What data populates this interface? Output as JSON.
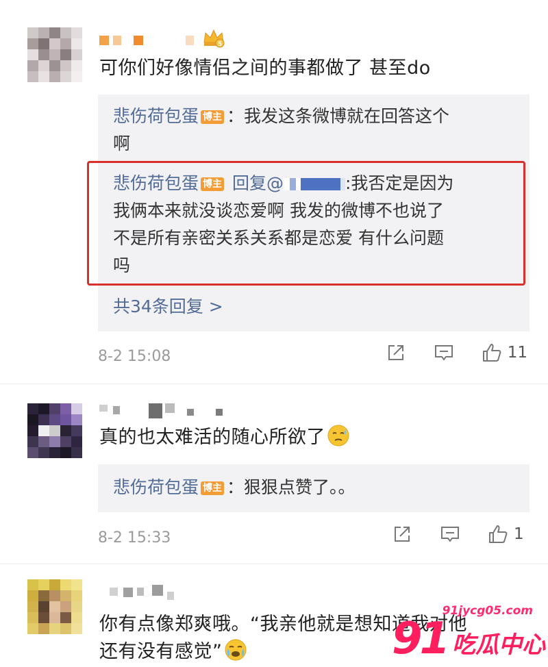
{
  "comments": [
    {
      "text": "可你们好像情侣之间的事都做了 甚至do",
      "replies": [
        {
          "name": "悲伤荷包蛋",
          "badge": "博主",
          "text": "：我发这条微博就在回答这个",
          "text2": "啊"
        },
        {
          "name": "悲伤荷包蛋",
          "badge": "博主",
          "reply_prefix": "回复@",
          "text": ":我否定是因为",
          "text2": "我俩本来就没谈恋爱啊 我发的微博不也说了",
          "text3": "不是所有亲密关系关系都是恋爱 有什么问题",
          "text4": "吗"
        }
      ],
      "more_replies": "共34条回复 >",
      "time": "8-2 15:08",
      "likes": "11"
    },
    {
      "text": "真的也太难活的随心所欲了",
      "replies": [
        {
          "name": "悲伤荷包蛋",
          "badge": "博主",
          "text": "：狠狠点赞了。。"
        }
      ],
      "time": "8-2 15:33",
      "likes": "1"
    },
    {
      "text": "你有点像郑爽哦。“我亲他就是想知道我对他",
      "text2": "还有没有感觉”"
    }
  ],
  "icons": [
    "share-icon",
    "comment-icon",
    "like-icon",
    "crown-icon",
    "sweat-emoji-icon",
    "crying-emoji-icon"
  ],
  "colors": {
    "accent": "#526b97",
    "badge": "#f49c36",
    "highlight": "#d9302c",
    "watermark": "#ff1f5e"
  },
  "watermark": {
    "url": "91jycg05.com",
    "number": "91",
    "text": "吃瓜中心"
  }
}
